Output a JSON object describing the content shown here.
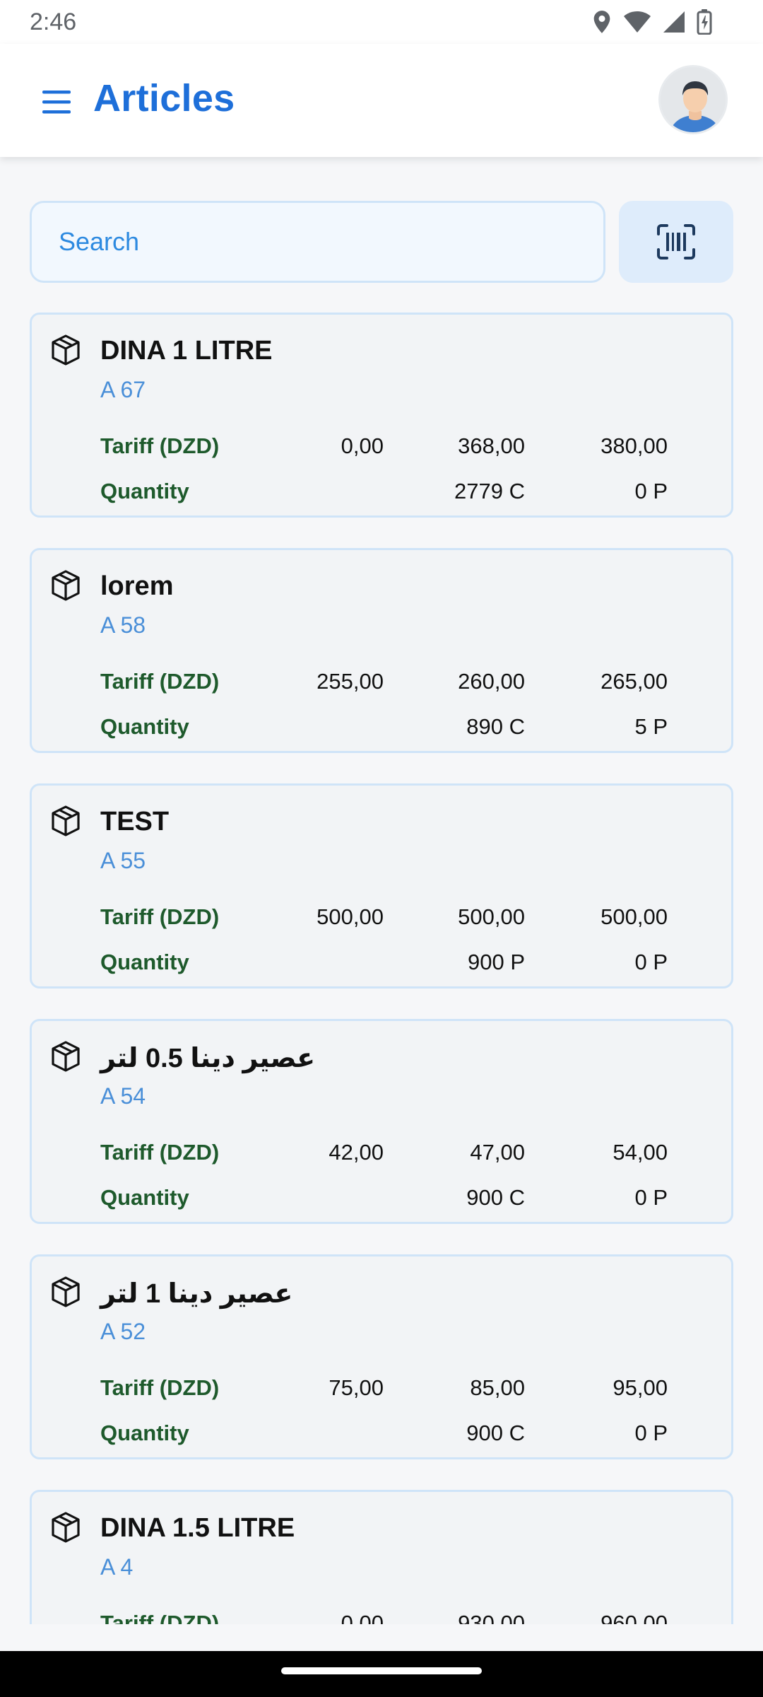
{
  "status": {
    "time": "2:46"
  },
  "app": {
    "title": "Articles"
  },
  "search": {
    "placeholder": "Search"
  },
  "labels": {
    "tariff": "Tariff (DZD)",
    "quantity": "Quantity"
  },
  "articles": [
    {
      "name": "DINA 1 LITRE",
      "code": "A 67",
      "tariff": [
        "0,00",
        "368,00",
        "380,00"
      ],
      "quantity": [
        "2779 C",
        "0 P"
      ]
    },
    {
      "name": "lorem",
      "code": "A 58",
      "tariff": [
        "255,00",
        "260,00",
        "265,00"
      ],
      "quantity": [
        "890 C",
        "5 P"
      ]
    },
    {
      "name": "TEST",
      "code": "A 55",
      "tariff": [
        "500,00",
        "500,00",
        "500,00"
      ],
      "quantity": [
        "900 P",
        "0 P"
      ]
    },
    {
      "name": "عصير دينا 0.5 لتر",
      "code": "A 54",
      "tariff": [
        "42,00",
        "47,00",
        "54,00"
      ],
      "quantity": [
        "900 C",
        "0 P"
      ]
    },
    {
      "name": "عصير دينا 1 لتر",
      "code": "A 52",
      "tariff": [
        "75,00",
        "85,00",
        "95,00"
      ],
      "quantity": [
        "900 C",
        "0 P"
      ]
    },
    {
      "name": "DINA 1.5 LITRE",
      "code": "A 4",
      "tariff": [
        "0,00",
        "930,00",
        "960,00"
      ],
      "quantity": [
        "",
        ""
      ]
    }
  ]
}
